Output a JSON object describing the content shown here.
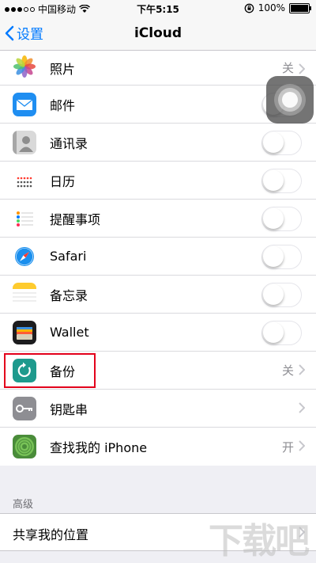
{
  "status_bar": {
    "carrier": "中国移动",
    "time": "下午5:15",
    "battery": "100%",
    "battery_level": 1.0
  },
  "nav": {
    "back_label": "设置",
    "title": "iCloud"
  },
  "items": [
    {
      "label": "照片",
      "value": "关",
      "icon": "photos-icon"
    },
    {
      "label": "邮件",
      "icon": "mail-icon"
    },
    {
      "label": "通讯录",
      "icon": "contacts-icon"
    },
    {
      "label": "日历",
      "icon": "calendar-icon"
    },
    {
      "label": "提醒事项",
      "icon": "reminders-icon"
    },
    {
      "label": "Safari",
      "icon": "safari-icon"
    },
    {
      "label": "备忘录",
      "icon": "notes-icon"
    },
    {
      "label": "Wallet",
      "icon": "wallet-icon"
    },
    {
      "label": "备份",
      "value": "关",
      "icon": "backup-icon"
    },
    {
      "label": "钥匙串",
      "icon": "keychain-icon"
    },
    {
      "label": "查找我的 iPhone",
      "value": "开",
      "icon": "find-iphone-icon"
    }
  ],
  "advanced": {
    "header": "高级",
    "share_location": "共享我的位置"
  },
  "watermark": "下载吧",
  "colors": {
    "accent": "#007aff",
    "highlight": "#e3001b"
  }
}
